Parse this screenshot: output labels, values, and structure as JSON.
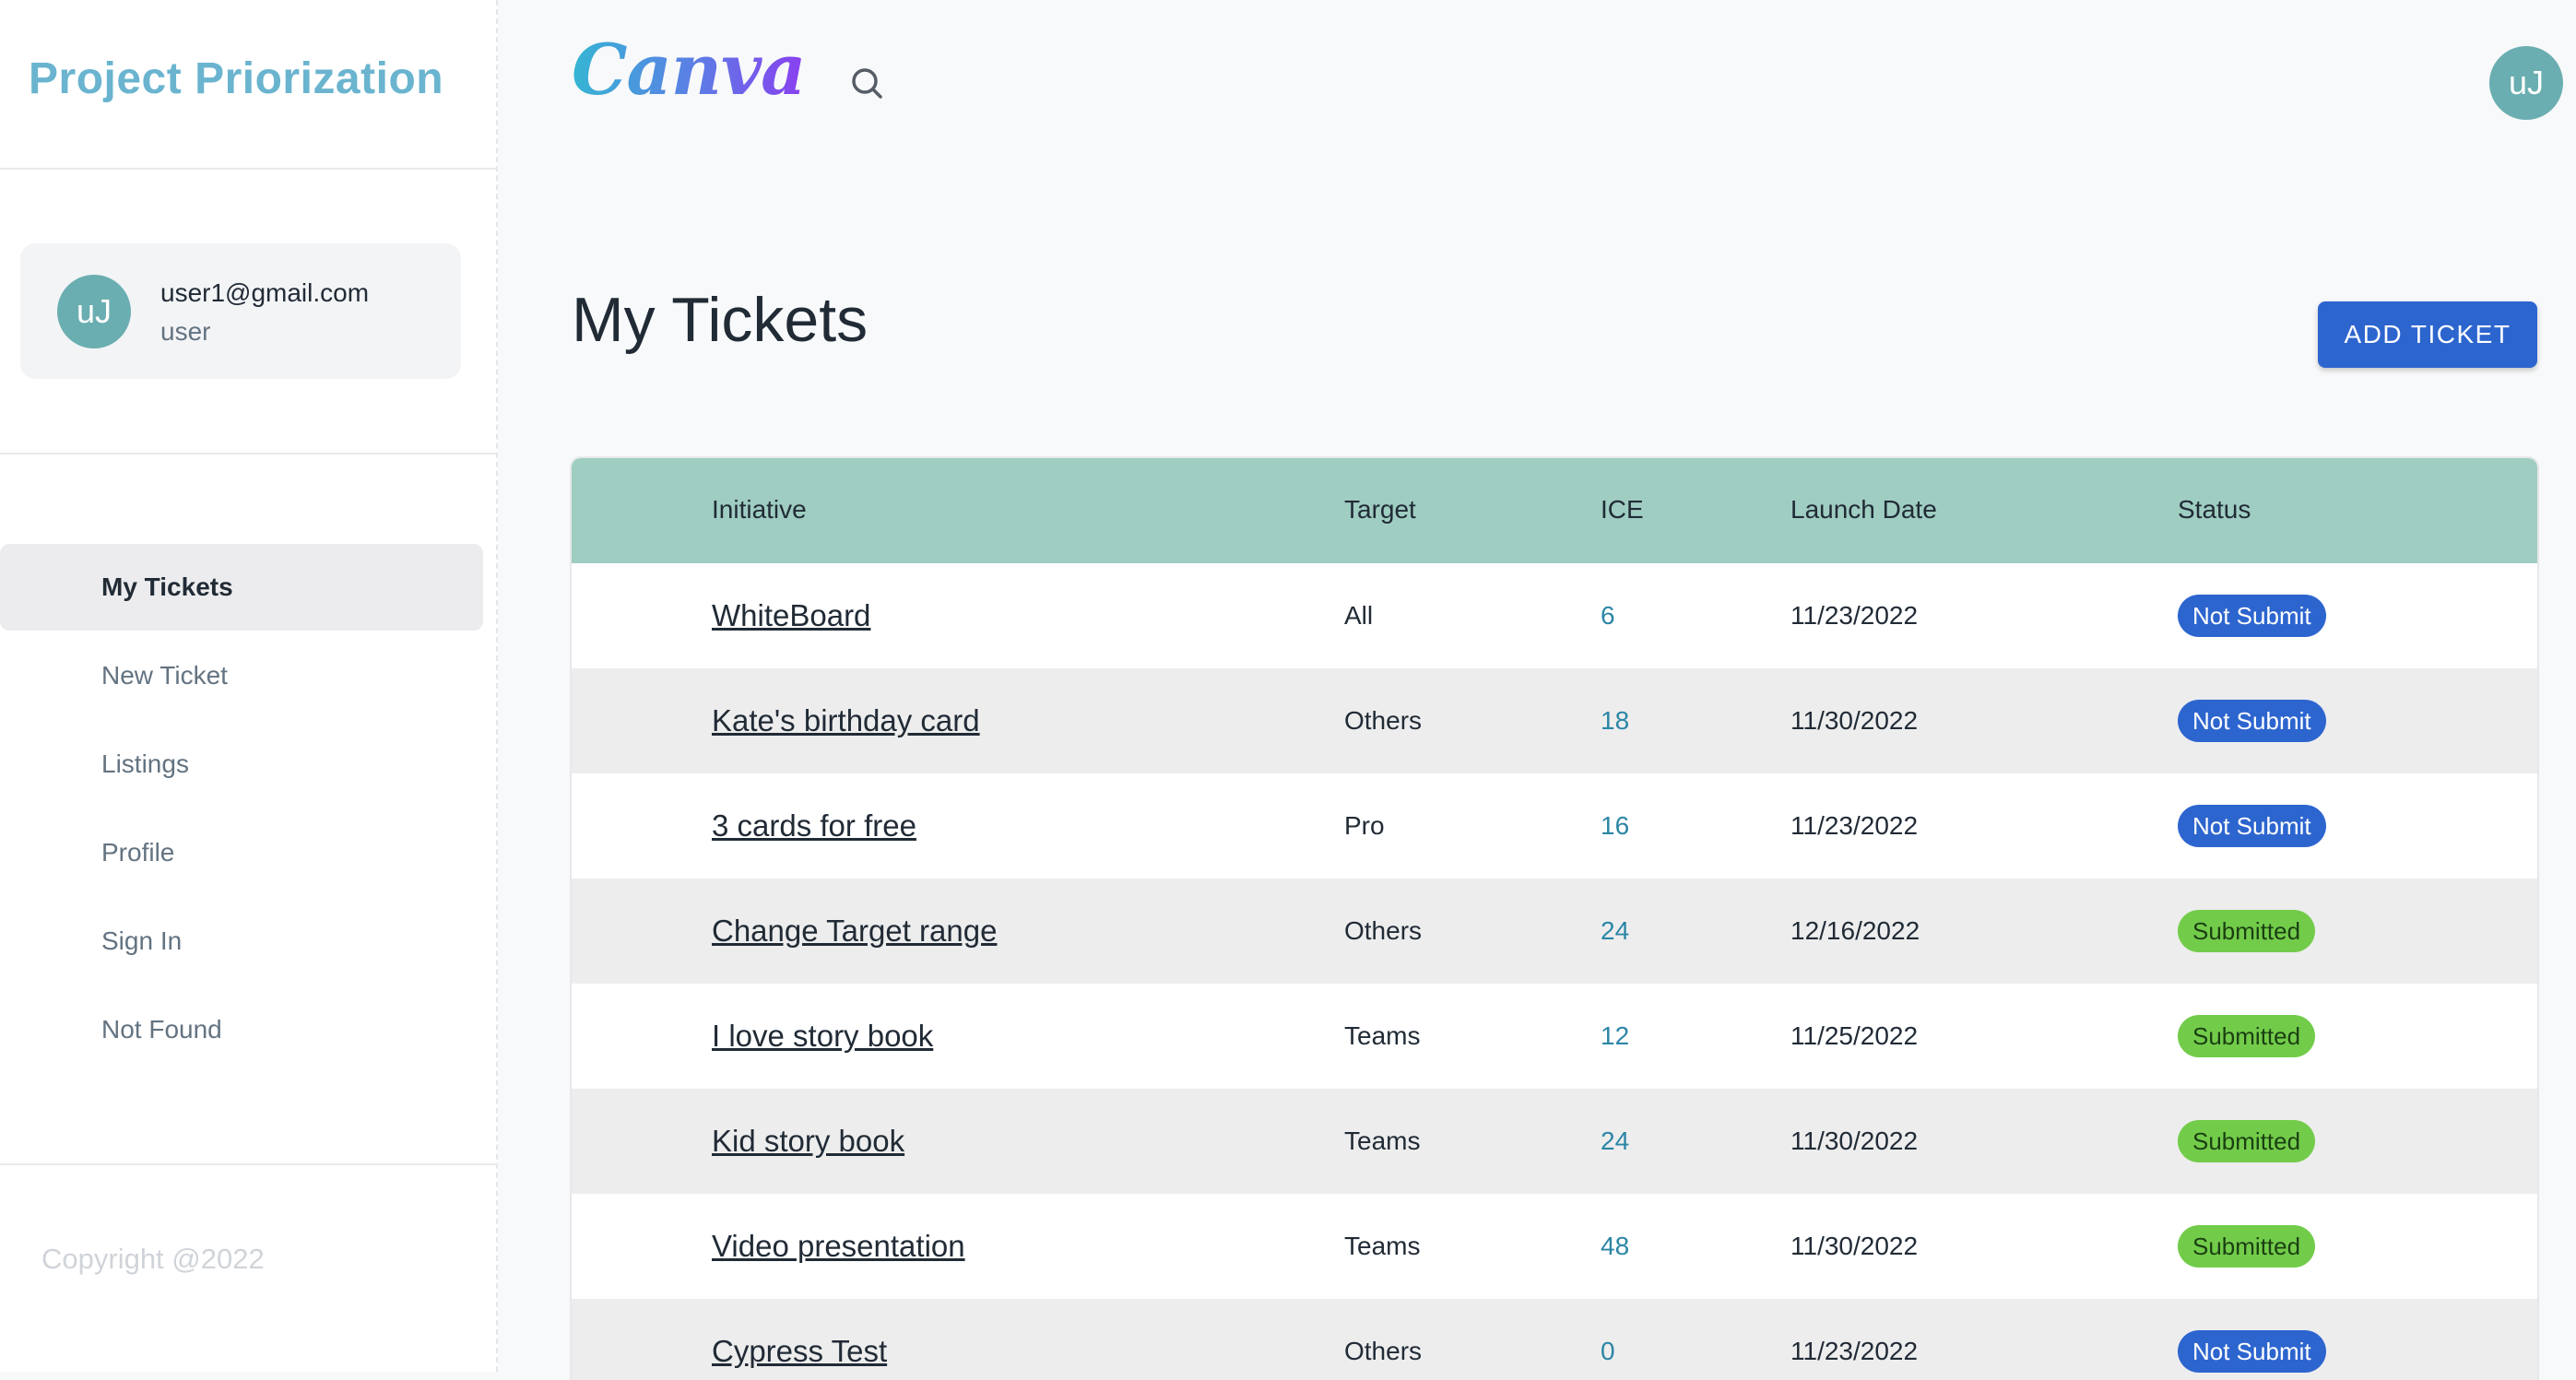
{
  "sidebar": {
    "brand": "Project Priorization",
    "user": {
      "avatar_initials": "uJ",
      "email": "user1@gmail.com",
      "role": "user"
    },
    "nav": [
      {
        "label": "My Tickets",
        "active": true
      },
      {
        "label": "New Ticket",
        "active": false
      },
      {
        "label": "Listings",
        "active": false
      },
      {
        "label": "Profile",
        "active": false
      },
      {
        "label": "Sign In",
        "active": false
      },
      {
        "label": "Not Found",
        "active": false
      }
    ],
    "copyright": "Copyright @2022"
  },
  "header": {
    "logo": "Canva",
    "search_icon": "search-icon",
    "avatar_initials": "uJ"
  },
  "main": {
    "title": "My Tickets",
    "add_button": "ADD TICKET",
    "columns": [
      "Initiative",
      "Target",
      "ICE",
      "Launch Date",
      "Status"
    ],
    "rows": [
      {
        "initiative": "WhiteBoard",
        "target": "All",
        "ice": "6",
        "date": "11/23/2022",
        "status": "Not Submit"
      },
      {
        "initiative": "Kate's birthday card",
        "target": "Others",
        "ice": "18",
        "date": "11/30/2022",
        "status": "Not Submit"
      },
      {
        "initiative": "3 cards for free",
        "target": "Pro",
        "ice": "16",
        "date": "11/23/2022",
        "status": "Not Submit"
      },
      {
        "initiative": "Change Target range",
        "target": "Others",
        "ice": "24",
        "date": "12/16/2022",
        "status": "Submitted"
      },
      {
        "initiative": "I love story book",
        "target": "Teams",
        "ice": "12",
        "date": "11/25/2022",
        "status": "Submitted"
      },
      {
        "initiative": "Kid story book",
        "target": "Teams",
        "ice": "24",
        "date": "11/30/2022",
        "status": "Submitted"
      },
      {
        "initiative": "Video presentation",
        "target": "Teams",
        "ice": "48",
        "date": "11/30/2022",
        "status": "Submitted"
      },
      {
        "initiative": "Cypress Test",
        "target": "Others",
        "ice": "0",
        "date": "11/23/2022",
        "status": "Not Submit"
      }
    ]
  },
  "colors": {
    "brand": "#6ab4cf",
    "header_row": "#9fcdc1",
    "not_submit": "#2d65cf",
    "submitted": "#72cc4a",
    "ice_text": "#2b86a6",
    "avatar": "#6aaeb1"
  }
}
